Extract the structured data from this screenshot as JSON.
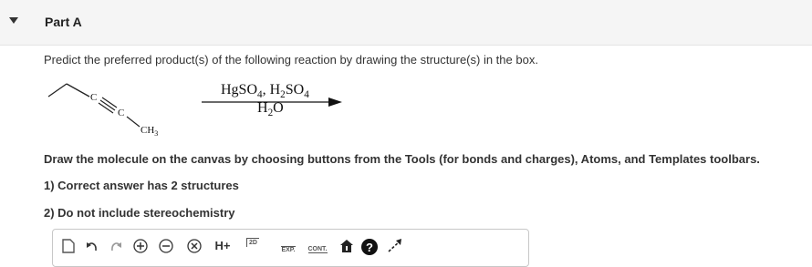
{
  "header": {
    "chevron_icon": "chevron-down-icon",
    "part_title": "Part A"
  },
  "question": "Predict the preferred product(s) of the following reaction by drawing the structure(s) in the box.",
  "reaction": {
    "reactant_labels": {
      "c1": "C",
      "c2": "C",
      "methyl": "CH3"
    },
    "reagents_top": "HgSO4, H2SO4",
    "reagents_bottom": "H2O"
  },
  "instructions": "Draw the molecule on the canvas by choosing buttons from the Tools (for bonds and charges), Atoms, and Templates toolbars.",
  "rules": [
    "1)  Correct answer has 2 structures",
    "2)  Do not include stereochemistry"
  ],
  "toolbar": {
    "tools": [
      {
        "name": "select-icon"
      },
      {
        "name": "undo-icon"
      },
      {
        "name": "redo-icon"
      },
      {
        "name": "increase-charge-icon"
      },
      {
        "name": "decrease-charge-icon"
      },
      {
        "name": "delete-icon"
      },
      {
        "name": "add-hydrogen",
        "label": "H+"
      },
      {
        "name": "2d-clean",
        "label": "2D"
      },
      {
        "name": "expand",
        "label": "EXP."
      },
      {
        "name": "contract",
        "label": "CONT."
      },
      {
        "name": "info-icon"
      },
      {
        "name": "help-icon"
      },
      {
        "name": "expand-window-icon"
      }
    ]
  }
}
